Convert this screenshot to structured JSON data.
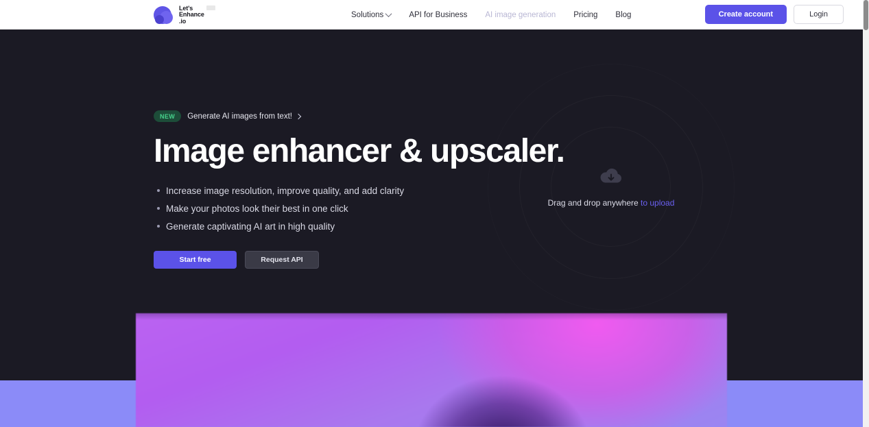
{
  "header": {
    "logo": {
      "name": "Let's Enhance",
      "line1": "Let's",
      "line2": "Enhance",
      "line3": ".io"
    },
    "nav": [
      {
        "label": "Solutions",
        "muted": false,
        "has_chevron": true
      },
      {
        "label": "API for Business",
        "muted": false,
        "has_chevron": false
      },
      {
        "label": "AI image generation",
        "muted": true,
        "has_chevron": false
      },
      {
        "label": "Pricing",
        "muted": false,
        "has_chevron": false
      },
      {
        "label": "Blog",
        "muted": false,
        "has_chevron": false
      }
    ],
    "create_account_label": "Create account",
    "login_label": "Login"
  },
  "hero": {
    "badge_new": "NEW",
    "badge_link": "Generate AI images from text!",
    "title": "Image enhancer & upscaler.",
    "bullets": [
      "Increase image resolution, improve quality, and add clarity",
      "Make your photos look their best in one click",
      "Generate captivating AI art in high quality"
    ],
    "start_free_label": "Start free",
    "request_api_label": "Request API",
    "dropzone": {
      "text": "Drag and drop anywhere",
      "link": "to upload",
      "icon": "cloud-upload-icon"
    }
  },
  "colors": {
    "accent_purple": "#5b52e8",
    "link_purple": "#6a60f0",
    "badge_green_bg": "#1d4d39",
    "badge_green_text": "#46d18c",
    "hero_background": "#1b1a24",
    "header_background": "#ffffff",
    "footer_band": "#8b8bf8",
    "nav_muted": "#b9b7d4"
  }
}
